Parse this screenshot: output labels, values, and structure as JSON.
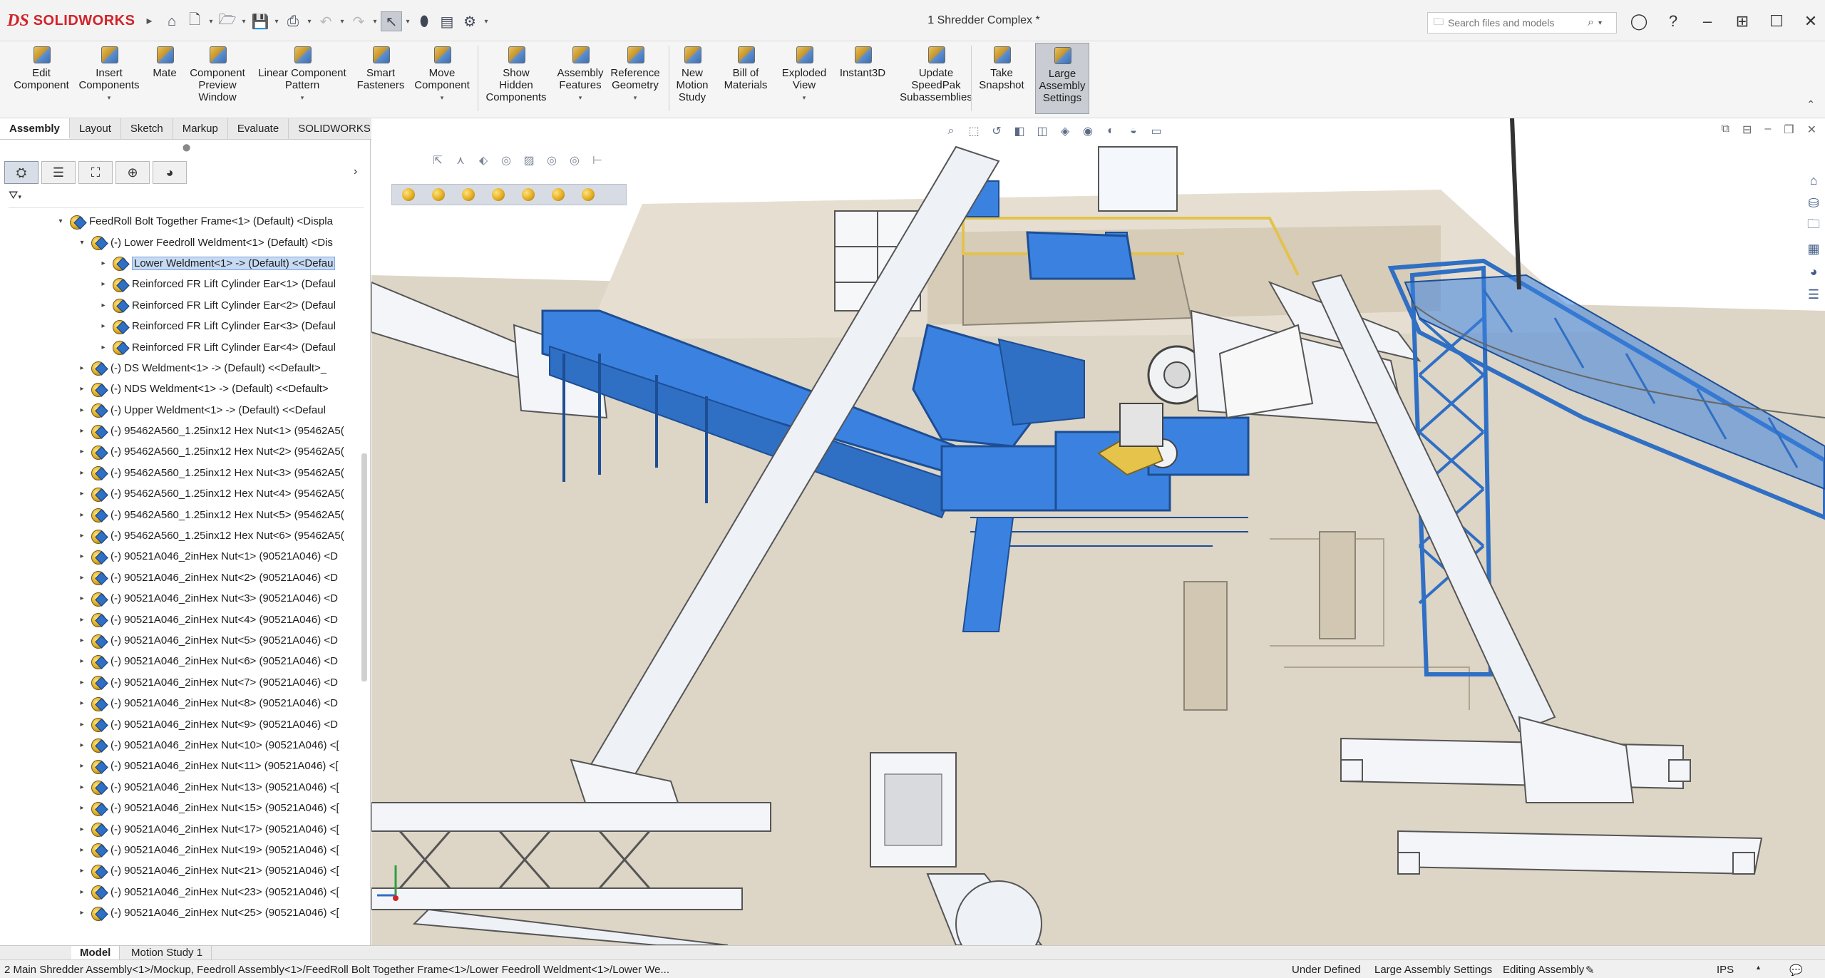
{
  "app": {
    "logo_ds": "DS",
    "logo_name": "SOLIDWORKS",
    "document_title": "1 Shredder Complex *"
  },
  "search": {
    "placeholder": "Search files and models"
  },
  "ribbon": {
    "buttons": [
      {
        "label": "Edit\nComponent",
        "dropdown": false
      },
      {
        "label": "Insert\nComponents",
        "dropdown": true
      },
      {
        "label": "Mate",
        "dropdown": false
      },
      {
        "label": "Component\nPreview\nWindow",
        "dropdown": false
      },
      {
        "label": "Linear Component\nPattern",
        "dropdown": true
      },
      {
        "label": "Smart\nFasteners",
        "dropdown": false
      },
      {
        "label": "Move\nComponent",
        "dropdown": true
      },
      {
        "label": "Show\nHidden\nComponents",
        "dropdown": false
      },
      {
        "label": "Assembly\nFeatures",
        "dropdown": true
      },
      {
        "label": "Reference\nGeometry",
        "dropdown": true
      },
      {
        "label": "New\nMotion\nStudy",
        "dropdown": false
      },
      {
        "label": "Bill of\nMaterials",
        "dropdown": false
      },
      {
        "label": "Exploded\nView",
        "dropdown": true
      },
      {
        "label": "Instant3D",
        "dropdown": false
      },
      {
        "label": "Update\nSpeedPak\nSubassemblies",
        "dropdown": false
      },
      {
        "label": "Take\nSnapshot",
        "dropdown": false
      },
      {
        "label": "Large\nAssembly\nSettings",
        "dropdown": false
      }
    ]
  },
  "tabs": [
    "Assembly",
    "Layout",
    "Sketch",
    "Markup",
    "Evaluate",
    "SOLIDWORKS Add-Ins"
  ],
  "tree": {
    "rows": [
      {
        "label": "FeedRoll Bolt Together Frame<1> (Default) <Displa",
        "expanded": true
      },
      {
        "label": "(-) Lower Feedroll Weldment<1> (Default) <Dis",
        "expanded": true
      },
      {
        "label": "Lower Weldment<1> -> (Default) <<Defau",
        "expanded": false
      },
      {
        "label": "Reinforced FR Lift Cylinder Ear<1> (Defaul",
        "expanded": false
      },
      {
        "label": "Reinforced FR Lift Cylinder Ear<2> (Defaul",
        "expanded": false
      },
      {
        "label": "Reinforced FR Lift Cylinder Ear<3> (Defaul",
        "expanded": false
      },
      {
        "label": "Reinforced FR Lift Cylinder Ear<4> (Defaul",
        "expanded": false
      },
      {
        "label": "(-) DS Weldment<1> -> (Default) <<Default>_",
        "expanded": false
      },
      {
        "label": "(-) NDS Weldment<1> -> (Default) <<Default>",
        "expanded": false
      },
      {
        "label": "(-) Upper Weldment<1> -> (Default) <<Defaul",
        "expanded": false
      },
      {
        "label": "(-) 95462A560_1.25inx12 Hex Nut<1> (95462A5(",
        "expanded": false
      },
      {
        "label": "(-) 95462A560_1.25inx12 Hex Nut<2> (95462A5(",
        "expanded": false
      },
      {
        "label": "(-) 95462A560_1.25inx12 Hex Nut<3> (95462A5(",
        "expanded": false
      },
      {
        "label": "(-) 95462A560_1.25inx12 Hex Nut<4> (95462A5(",
        "expanded": false
      },
      {
        "label": "(-) 95462A560_1.25inx12 Hex Nut<5> (95462A5(",
        "expanded": false
      },
      {
        "label": "(-) 95462A560_1.25inx12 Hex Nut<6> (95462A5(",
        "expanded": false
      },
      {
        "label": "(-) 90521A046_2inHex Nut<1> (90521A046) <D",
        "expanded": false
      },
      {
        "label": "(-) 90521A046_2inHex Nut<2> (90521A046) <D",
        "expanded": false
      },
      {
        "label": "(-) 90521A046_2inHex Nut<3> (90521A046) <D",
        "expanded": false
      },
      {
        "label": "(-) 90521A046_2inHex Nut<4> (90521A046) <D",
        "expanded": false
      },
      {
        "label": "(-) 90521A046_2inHex Nut<5> (90521A046) <D",
        "expanded": false
      },
      {
        "label": "(-) 90521A046_2inHex Nut<6> (90521A046) <D",
        "expanded": false
      },
      {
        "label": "(-) 90521A046_2inHex Nut<7> (90521A046) <D",
        "expanded": false
      },
      {
        "label": "(-) 90521A046_2inHex Nut<8> (90521A046) <D",
        "expanded": false
      },
      {
        "label": "(-) 90521A046_2inHex Nut<9> (90521A046) <D",
        "expanded": false
      },
      {
        "label": "(-) 90521A046_2inHex Nut<10> (90521A046) <[",
        "expanded": false
      },
      {
        "label": "(-) 90521A046_2inHex Nut<11> (90521A046) <[",
        "expanded": false
      },
      {
        "label": "(-) 90521A046_2inHex Nut<13> (90521A046) <[",
        "expanded": false
      },
      {
        "label": "(-) 90521A046_2inHex Nut<15> (90521A046) <[",
        "expanded": false
      },
      {
        "label": "(-) 90521A046_2inHex Nut<17> (90521A046) <[",
        "expanded": false
      },
      {
        "label": "(-) 90521A046_2inHex Nut<19> (90521A046) <[",
        "expanded": false
      },
      {
        "label": "(-) 90521A046_2inHex Nut<21> (90521A046) <[",
        "expanded": false
      },
      {
        "label": "(-) 90521A046_2inHex Nut<23> (90521A046) <[",
        "expanded": false
      },
      {
        "label": "(-) 90521A046_2inHex Nut<25> (90521A046) <[",
        "expanded": false
      }
    ]
  },
  "bottom_tabs": [
    "Model",
    "Motion Study 1"
  ],
  "status": {
    "path": "2 Main Shredder Assembly<1>/Mockup, Feedroll Assembly<1>/FeedRoll Bolt Together Frame<1>/Lower Feedroll Weldment<1>/Lower We...",
    "state": "Under Defined",
    "settings": "Large Assembly Settings",
    "mode": "Editing Assembly",
    "units": "IPS"
  },
  "colors": {
    "accent": "#3d7fd6",
    "selection": "#c7daf3",
    "floor": "#ddd4c4",
    "steel_blue": "#3b82e0"
  }
}
